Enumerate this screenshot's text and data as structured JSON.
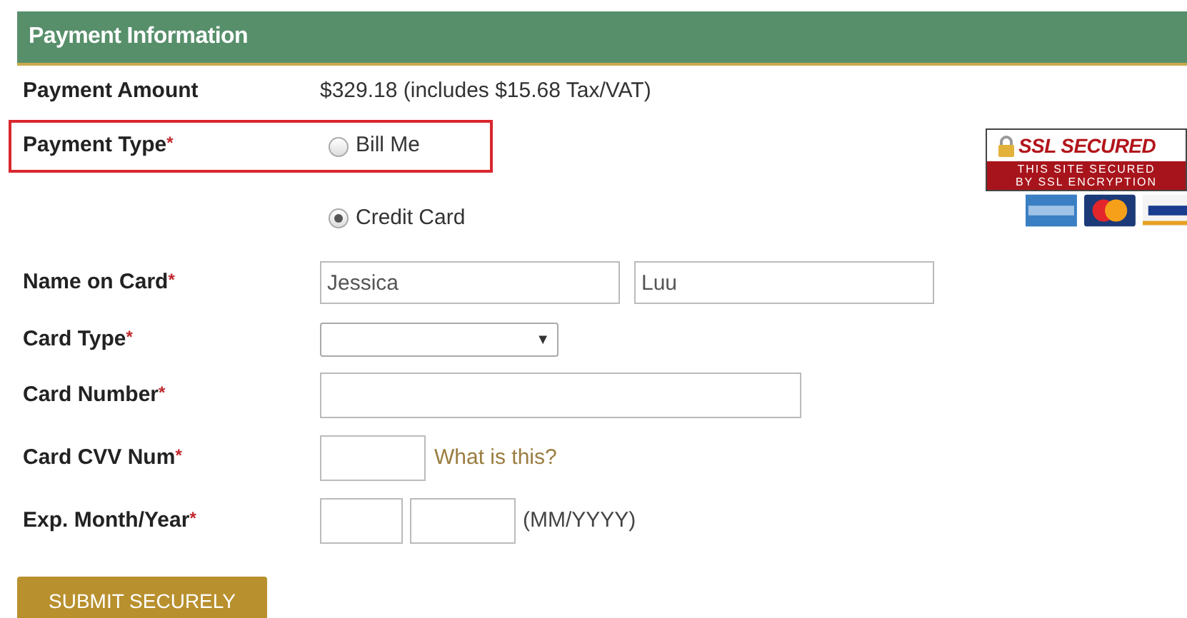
{
  "header": {
    "title": "Payment Information"
  },
  "amount": {
    "label": "Payment Amount",
    "value": "$329.18 (includes $15.68 Tax/VAT)"
  },
  "payment_type": {
    "label": "Payment Type",
    "required_mark": "*",
    "highlighted": true,
    "options": [
      {
        "label": "Bill Me",
        "selected": false
      },
      {
        "label": "Credit Card",
        "selected": true
      }
    ]
  },
  "fields": [
    {
      "kind": "name",
      "label": "Name on Card",
      "required_mark": "*",
      "inputs": [
        {
          "value": "Jessica"
        },
        {
          "value": "Luu"
        }
      ]
    },
    {
      "kind": "select",
      "label": "Card Type",
      "required_mark": "*",
      "caret": "▼"
    },
    {
      "kind": "number",
      "label": "Card Number",
      "required_mark": "*"
    },
    {
      "kind": "cvv",
      "label": "Card CVV Num",
      "required_mark": "*",
      "link": "What is this?"
    },
    {
      "kind": "expiry",
      "label": "Exp. Month/Year",
      "required_mark": "*",
      "hint": "(MM/YYYY)"
    }
  ],
  "submit": {
    "label": "SUBMIT SECURELY"
  },
  "ssl_badge": {
    "title": "SSL SECURED",
    "lines": [
      "THIS SITE SECURED",
      "BY SSL ENCRYPTION"
    ]
  }
}
